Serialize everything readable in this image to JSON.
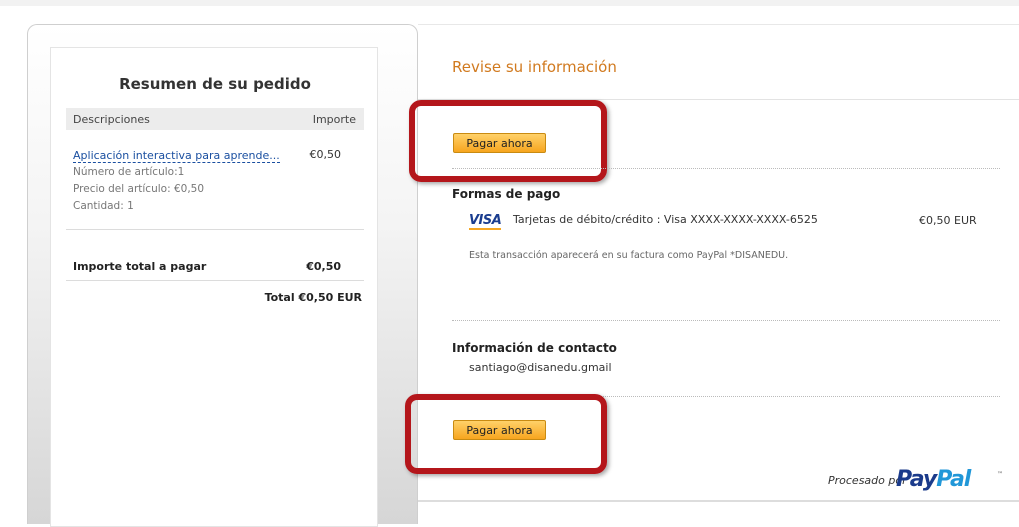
{
  "summary": {
    "title": "Resumen de su pedido",
    "col_desc": "Descripciones",
    "col_amount": "Importe",
    "item": {
      "name": "Aplicación interactiva para aprende...",
      "price": "€0,50",
      "number": "Número de artículo:1",
      "unit_price": "Precio del artículo: €0,50",
      "quantity": "Cantidad: 1"
    },
    "total_label": "Importe total a pagar",
    "total_amount": "€0,50",
    "grand_total": "Total €0,50 EUR"
  },
  "review": {
    "title": "Revise su información",
    "pay_button": "Pagar ahora",
    "payment_heading": "Formas de pago",
    "card_brand": "VISA",
    "card_text": "Tarjetas de débito/crédito : Visa XXXX-XXXX-XXXX-6525",
    "card_amount": "€0,50 EUR",
    "statement_note": "Esta transacción aparecerá en su factura como PayPal *DISANEDU.",
    "contact_heading": "Información de contacto",
    "email": "santiago@disanedu.gmail",
    "pay_button_bottom": "Pagar ahora"
  },
  "footer": {
    "processed_by": "Procesado por",
    "brand_pay": "Pay",
    "brand_pal": "Pal",
    "trademark": "™"
  },
  "colors": {
    "accent_title": "#d17a1f",
    "link": "#1a4fa0",
    "button": "#f7a51f",
    "highlight": "#b4161b"
  }
}
